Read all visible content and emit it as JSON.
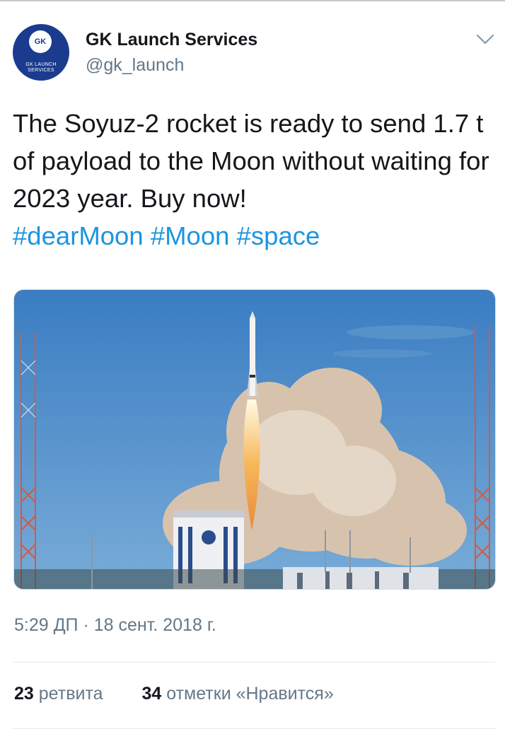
{
  "colors": {
    "accent": "#1b95e0",
    "avatar_bg": "#1b3b8f",
    "secondary_text": "#657786"
  },
  "author": {
    "name": "GK Launch Services",
    "handle": "@gk_launch",
    "avatar_badge": "GK",
    "avatar_tagline": "GK LAUNCH SERVICES"
  },
  "menu_icon": "chevron-down-icon",
  "tweet": {
    "text": "The Soyuz-2 rocket is ready to send 1.7 t of payload to the Moon without waiting for 2023 year. Buy now!",
    "hashtags": [
      "#dearMoon",
      "#Moon",
      "#space"
    ]
  },
  "media": {
    "description_icon": "rocket-launch-photo"
  },
  "timestamp": "5:29 ДП · 18 сент. 2018 г.",
  "stats": {
    "retweets_count": "23",
    "retweets_label": "ретвита",
    "likes_count": "34",
    "likes_label": "отметки «Нравится»"
  }
}
